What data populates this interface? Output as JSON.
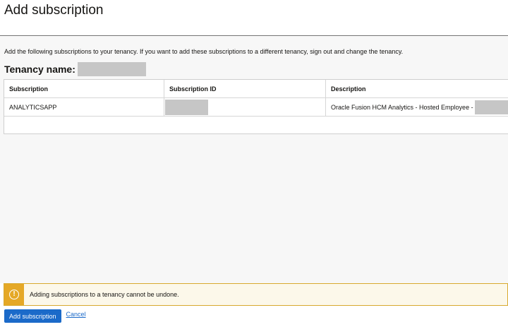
{
  "page": {
    "title": "Add subscription",
    "intro": "Add the following subscriptions to your tenancy. If you want to add these subscriptions to a different tenancy, sign out and change the tenancy.",
    "tenancy_label": "Tenancy name:"
  },
  "table": {
    "headers": [
      "Subscription",
      "Subscription ID",
      "Description"
    ],
    "rows": [
      {
        "subscription": "ANALYTICSAPP",
        "description": "Oracle Fusion HCM Analytics - Hosted Employee -"
      }
    ]
  },
  "warning": {
    "icon": "exclamation-circle-icon",
    "text": "Adding subscriptions to a tenancy cannot be undone."
  },
  "actions": {
    "primary_label": "Add subscription",
    "cancel_label": "Cancel"
  },
  "colors": {
    "primary": "#1b6ac9",
    "warning_accent": "#e5a826",
    "warning_bg": "#fcf8ea",
    "redaction": "#c6c6c6"
  }
}
